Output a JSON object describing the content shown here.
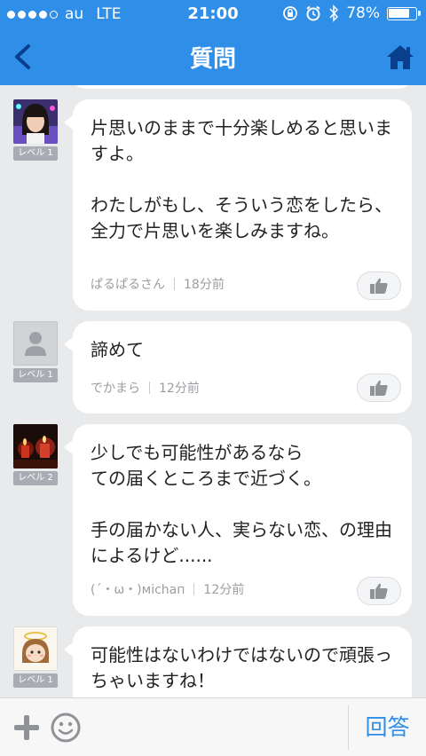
{
  "status_bar": {
    "carrier": "au",
    "network": "LTE",
    "time": "21:00",
    "battery_percent": "78%",
    "battery_level": 0.78,
    "signal_bars": 4
  },
  "nav": {
    "title": "質問",
    "back_icon": "chevron-left-icon",
    "home_icon": "home-icon",
    "accent_color": "#2e8ee8"
  },
  "answers": [
    {
      "level": "レベル 1",
      "text": "片思いのままで十分楽しめると思いますよ。\n\nわたしがもし、そういう恋をしたら、全力で片思いを楽しみますね。",
      "author": "ぱるぱるさん",
      "time": "18分前"
    },
    {
      "level": "レベル 1",
      "text": "諦めて",
      "author": "でかまら",
      "time": "12分前"
    },
    {
      "level": "レベル 2",
      "text": "少しでも可能性があるなら\nての届くところまで近づく。\n\n手の届かない人、実らない恋、の理由によるけど......",
      "author": "(´・ω・)місhап",
      "time": "12分前"
    },
    {
      "level": "レベル 1",
      "text": "可能性はないわけではないので頑張っちゃいますね！"
    }
  ],
  "bottom_bar": {
    "answer_label": "回答"
  }
}
